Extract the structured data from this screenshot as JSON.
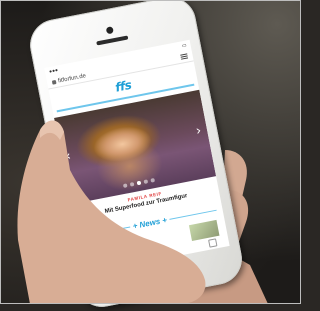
{
  "browser": {
    "url": "fitforfun.de"
  },
  "site": {
    "logo_text": "ffs"
  },
  "slider": {
    "prev_icon": "chevron-left",
    "next_icon": "chevron-right",
    "dot_count": 5,
    "active_index": 2
  },
  "article": {
    "category": "FAMILA REIF",
    "headline": "Mit Superfood zur Traumfigur"
  },
  "section": {
    "label": "+ News +"
  },
  "colors": {
    "brand_blue": "#1f9fd6",
    "accent_red": "#e03d3d"
  }
}
